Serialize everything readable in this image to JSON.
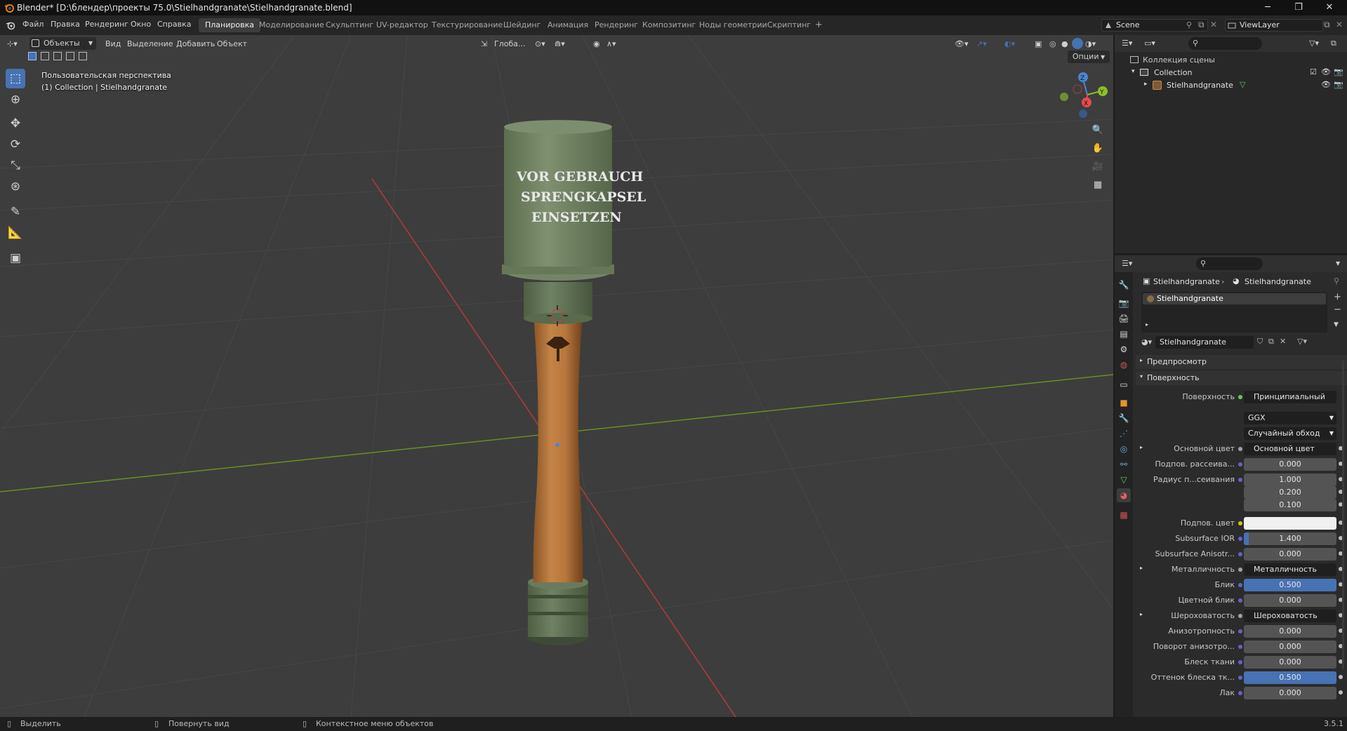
{
  "window": {
    "title": "Blender* [D:\\блендер\\проекты 75.0\\Stielhandgranate\\Stielhandgranate.blend]",
    "minimize": "─",
    "maximize": "❐",
    "close": "✕"
  },
  "menu": [
    "Файл",
    "Правка",
    "Рендеринг",
    "Окно",
    "Справка"
  ],
  "workspaces": [
    {
      "label": "Планировка",
      "active": true
    },
    {
      "label": "Моделирование"
    },
    {
      "label": "Скульптинг"
    },
    {
      "label": "UV-редактор"
    },
    {
      "label": "Текстурирование"
    },
    {
      "label": "Шейдинг"
    },
    {
      "label": "Анимация"
    },
    {
      "label": "Рендеринг"
    },
    {
      "label": "Композитинг"
    },
    {
      "label": "Ноды геометрии"
    },
    {
      "label": "Скриптинг"
    }
  ],
  "add_workspace": "+",
  "scene": {
    "name": "Scene",
    "view_layer": "ViewLayer"
  },
  "viewport": {
    "mode": "Объекты",
    "menus": [
      "Вид",
      "Выделение",
      "Добавить",
      "Объект"
    ],
    "orientation": "Глоба...",
    "options": "Опции",
    "view_name": "Пользовательская перспектива",
    "collection_info": "(1) Collection | Stielhandgranate",
    "object_text": [
      "VOR GEBRAUCH",
      "SPRENGKAPSEL",
      "EINSETZEN"
    ]
  },
  "outliner": {
    "scene_collection": "Коллекция сцены",
    "collection": "Collection",
    "object": "Stielhandgranate"
  },
  "properties": {
    "breadcrumb_object": "Stielhandgranate",
    "breadcrumb_material": "Stielhandgranate",
    "slot": "Stielhandgranate",
    "material_name": "Stielhandgranate",
    "panel_preview": "Предпросмотр",
    "panel_surface": "Поверхность",
    "surface_label": "Поверхность",
    "surface_value": "Принципиальный BSDF",
    "distribution": "GGX",
    "subsurface_method": "Случайный обход",
    "rows": [
      {
        "label": "Основной цвет",
        "value": "Основной цвет",
        "kind": "link",
        "expand": true
      },
      {
        "label": "Подпов. рассеива...",
        "value": "0.000",
        "kind": "num"
      },
      {
        "label": "Радиус п...сеивания",
        "value": "1.000",
        "kind": "num"
      },
      {
        "label": "",
        "value": "0.200",
        "kind": "num"
      },
      {
        "label": "",
        "value": "0.100",
        "kind": "num"
      },
      {
        "label": "Подпов. цвет",
        "value": "",
        "kind": "white"
      },
      {
        "label": "Subsurface IOR",
        "value": "1.400",
        "kind": "num",
        "fill": 0.05
      },
      {
        "label": "Subsurface Anisotr...",
        "value": "0.000",
        "kind": "num"
      },
      {
        "label": "Металличность",
        "value": "Металличность",
        "kind": "link",
        "expand": true
      },
      {
        "label": "Блик",
        "value": "0.500",
        "kind": "blue"
      },
      {
        "label": "Цветной блик",
        "value": "0.000",
        "kind": "num"
      },
      {
        "label": "Шероховатость",
        "value": "Шероховатость",
        "kind": "link",
        "expand": true
      },
      {
        "label": "Анизотропность",
        "value": "0.000",
        "kind": "num"
      },
      {
        "label": "Поворот анизотро...",
        "value": "0.000",
        "kind": "num"
      },
      {
        "label": "Блеск ткани",
        "value": "0.000",
        "kind": "num"
      },
      {
        "label": "Оттенок блеска тк...",
        "value": "0.500",
        "kind": "blue"
      },
      {
        "label": "Лак",
        "value": "0.000",
        "kind": "num"
      }
    ]
  },
  "status": {
    "select": "Выделить",
    "rotate": "Повернуть вид",
    "context": "Контекстное меню объектов",
    "version": "3.5.1"
  }
}
